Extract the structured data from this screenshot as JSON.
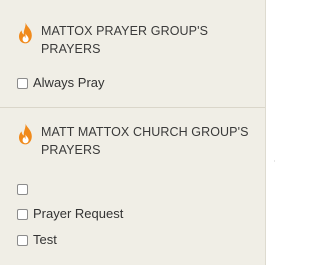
{
  "icon_color": "#f08a1c",
  "groups": [
    {
      "icon": "flame-icon",
      "title": "MATTOX PRAYER GROUP'S PRAYERS",
      "items": [
        {
          "label": "Always Pray",
          "checked": false
        }
      ]
    },
    {
      "icon": "flame-icon",
      "title": "MATT MATTOX CHURCH GROUP'S PRAYERS",
      "items": [
        {
          "label": "",
          "checked": false
        },
        {
          "label": "Prayer Request",
          "checked": false
        },
        {
          "label": "Test",
          "checked": false
        }
      ]
    }
  ]
}
